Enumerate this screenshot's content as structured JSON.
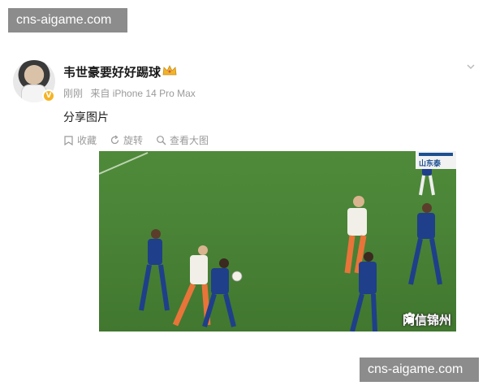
{
  "watermark": {
    "top": "cns-aigame.com",
    "bottom": "cns-aigame.com"
  },
  "post": {
    "username": "韦世豪要好好踢球",
    "meta": {
      "time": "刚刚",
      "source": "来自 iPhone 14 Pro Max"
    },
    "text": "分享图片",
    "toolbar": [
      {
        "icon": "bookmark-icon",
        "label": "收藏"
      },
      {
        "icon": "rotate-icon",
        "label": "旋转"
      },
      {
        "icon": "enlarge-icon",
        "label": "查看大图"
      }
    ],
    "photo": {
      "scoreboard_text": "山东泰",
      "watermark_text": "网信锦州"
    }
  },
  "colors": {
    "pitch": "#4a8437",
    "blue_kit": "#1f3f8a",
    "orange_white_kit": "#e8743a",
    "watermark_bg": "#8c8c8c"
  }
}
